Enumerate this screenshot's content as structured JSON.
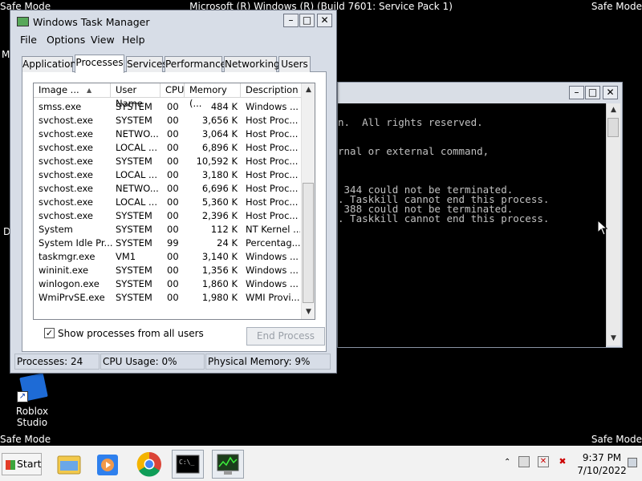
{
  "desktop": {
    "safe_mode": "Safe Mode",
    "build": "Microsoft (R) Windows (R) (Build 7601: Service Pack 1)",
    "edge_letters": [
      "M",
      "D"
    ],
    "icon_label": "Roblox Studio"
  },
  "cmd": {
    "lines": [
      "n.  All rights reserved.",
      "rnal or external command,",
      " 344 could not be terminated.",
      ". Taskkill cannot end this process.",
      " 388 could not be terminated.",
      ". Taskkill cannot end this process."
    ]
  },
  "taskmgr": {
    "title": "Windows Task Manager",
    "menu": [
      "File",
      "Options",
      "View",
      "Help"
    ],
    "tabs": [
      "Applications",
      "Processes",
      "Services",
      "Performance",
      "Networking",
      "Users"
    ],
    "active_tab": "Processes",
    "columns": [
      "Image ...",
      "User Name",
      "CPU",
      "Memory (...",
      "Description"
    ],
    "rows": [
      {
        "image": "smss.exe",
        "user": "SYSTEM",
        "cpu": "00",
        "mem": "484 K",
        "desc": "Windows ..."
      },
      {
        "image": "svchost.exe",
        "user": "SYSTEM",
        "cpu": "00",
        "mem": "3,656 K",
        "desc": "Host Proc..."
      },
      {
        "image": "svchost.exe",
        "user": "NETWO...",
        "cpu": "00",
        "mem": "3,064 K",
        "desc": "Host Proc..."
      },
      {
        "image": "svchost.exe",
        "user": "LOCAL ...",
        "cpu": "00",
        "mem": "6,896 K",
        "desc": "Host Proc..."
      },
      {
        "image": "svchost.exe",
        "user": "SYSTEM",
        "cpu": "00",
        "mem": "10,592 K",
        "desc": "Host Proc..."
      },
      {
        "image": "svchost.exe",
        "user": "LOCAL ...",
        "cpu": "00",
        "mem": "3,180 K",
        "desc": "Host Proc..."
      },
      {
        "image": "svchost.exe",
        "user": "NETWO...",
        "cpu": "00",
        "mem": "6,696 K",
        "desc": "Host Proc..."
      },
      {
        "image": "svchost.exe",
        "user": "LOCAL ...",
        "cpu": "00",
        "mem": "5,360 K",
        "desc": "Host Proc..."
      },
      {
        "image": "svchost.exe",
        "user": "SYSTEM",
        "cpu": "00",
        "mem": "2,396 K",
        "desc": "Host Proc..."
      },
      {
        "image": "System",
        "user": "SYSTEM",
        "cpu": "00",
        "mem": "112 K",
        "desc": "NT Kernel ..."
      },
      {
        "image": "System Idle Pr...",
        "user": "SYSTEM",
        "cpu": "99",
        "mem": "24 K",
        "desc": "Percentag..."
      },
      {
        "image": "taskmgr.exe",
        "user": "VM1",
        "cpu": "00",
        "mem": "3,140 K",
        "desc": "Windows ..."
      },
      {
        "image": "wininit.exe",
        "user": "SYSTEM",
        "cpu": "00",
        "mem": "1,356 K",
        "desc": "Windows ..."
      },
      {
        "image": "winlogon.exe",
        "user": "SYSTEM",
        "cpu": "00",
        "mem": "1,860 K",
        "desc": "Windows ..."
      },
      {
        "image": "WmiPrvSE.exe",
        "user": "SYSTEM",
        "cpu": "00",
        "mem": "1,980 K",
        "desc": "WMI Provi..."
      }
    ],
    "show_all_label": "Show processes from all users",
    "show_all_checked": true,
    "end_process_label": "End Process",
    "status": {
      "processes": "Processes: 24",
      "cpu": "CPU Usage: 0%",
      "memory": "Physical Memory: 9%"
    }
  },
  "taskbar": {
    "start_label": "Start",
    "time": "9:37 PM",
    "date": "7/10/2022",
    "icons": [
      "explorer-icon",
      "media-player-icon",
      "chrome-icon",
      "cmd-icon",
      "task-manager-icon"
    ]
  }
}
